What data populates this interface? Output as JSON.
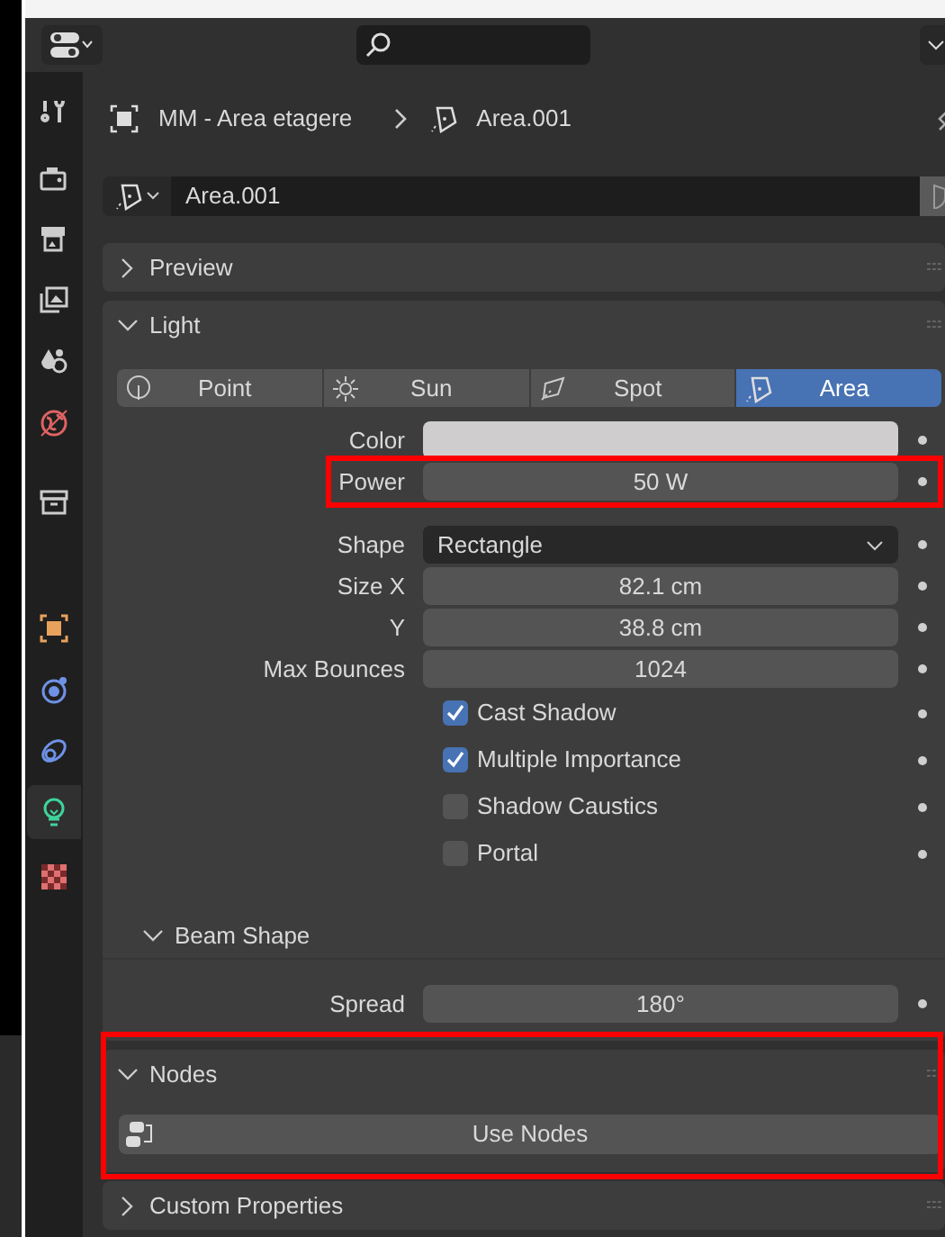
{
  "breadcrumb": [
    {
      "kind": "object",
      "label": "MM - Area etagere"
    },
    {
      "kind": "light",
      "label": "Area.001"
    }
  ],
  "datablock": {
    "value": "Area.001"
  },
  "sidebar": {
    "tabs": [
      {
        "kind": "tool",
        "selected": false
      },
      {
        "kind": "render",
        "selected": false
      },
      {
        "kind": "output",
        "selected": false
      },
      {
        "kind": "view_layer",
        "selected": false
      },
      {
        "kind": "scene",
        "selected": false
      },
      {
        "kind": "world",
        "selected": false
      },
      {
        "kind": "collection",
        "selected": false
      },
      {
        "kind": "object",
        "selected": false
      },
      {
        "kind": "physics",
        "selected": false
      },
      {
        "kind": "constraints",
        "selected": false
      },
      {
        "kind": "light",
        "selected": true
      },
      {
        "kind": "texture",
        "selected": false
      }
    ]
  },
  "panels": [
    {
      "title": "Preview",
      "expanded": false
    },
    {
      "kind": "light",
      "title": "Light",
      "expanded": true,
      "light_types": [
        {
          "kind": "point",
          "label": "Point",
          "selected": false
        },
        {
          "kind": "sun",
          "label": "Sun",
          "selected": false
        },
        {
          "kind": "spot",
          "label": "Spot",
          "selected": false
        },
        {
          "kind": "area",
          "label": "Area",
          "selected": true
        }
      ],
      "properties": [
        {
          "kind": "color",
          "label": "Color",
          "color": "#d0cdce"
        },
        {
          "kind": "number",
          "label": "Power",
          "value": "50 W",
          "highlighted": true
        },
        {
          "kind": "dropdown",
          "label": "Shape",
          "value": "Rectangle"
        },
        {
          "kind": "number",
          "label": "Size X",
          "value": "82.1 cm"
        },
        {
          "kind": "number",
          "label": "Y",
          "value": "38.8 cm"
        },
        {
          "kind": "number",
          "label": "Max Bounces",
          "value": "1024"
        },
        {
          "kind": "checkbox",
          "label": "Cast Shadow",
          "checked": true
        },
        {
          "kind": "checkbox",
          "label": "Multiple Importance",
          "checked": true
        },
        {
          "kind": "checkbox",
          "label": "Shadow Caustics",
          "checked": false
        },
        {
          "kind": "checkbox",
          "label": "Portal",
          "checked": false
        }
      ],
      "subpanel": {
        "title": "Beam Shape",
        "expanded": true,
        "properties": [
          {
            "kind": "number",
            "label": "Spread",
            "value": "180°"
          }
        ]
      }
    },
    {
      "kind": "nodes",
      "title": "Nodes",
      "expanded": true,
      "highlighted": true,
      "button": "Use Nodes"
    },
    {
      "title": "Custom Properties",
      "expanded": false
    }
  ]
}
